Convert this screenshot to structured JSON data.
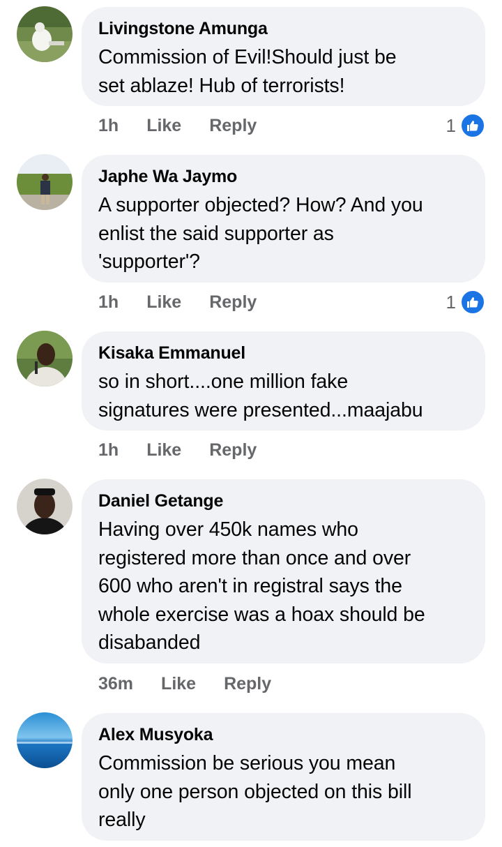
{
  "comments": [
    {
      "author": "Livingstone Amunga",
      "text": "Commission of Evil!Should just be\nset ablaze! Hub of terrorists!",
      "time": "1h",
      "like_label": "Like",
      "reply_label": "Reply",
      "reaction_count": "1",
      "avatar_icon": "avatar-photo"
    },
    {
      "author": "Japhe Wa Jaymo",
      "text": "A supporter objected? How? And you\nenlist the said supporter as\n'supporter'?",
      "time": "1h",
      "like_label": "Like",
      "reply_label": "Reply",
      "reaction_count": "1",
      "avatar_icon": "avatar-photo"
    },
    {
      "author": "Kisaka Emmanuel",
      "text": "so in short....one million fake\nsignatures were presented...maajabu",
      "time": "1h",
      "like_label": "Like",
      "reply_label": "Reply",
      "avatar_icon": "avatar-photo"
    },
    {
      "author": "Daniel Getange",
      "text": "Having over 450k names who\nregistered more than once and over\n600 who aren't in registral says the\nwhole exercise was a hoax should be\ndisabanded",
      "time": "36m",
      "like_label": "Like",
      "reply_label": "Reply",
      "avatar_icon": "avatar-photo"
    },
    {
      "author": "Alex Musyoka",
      "text": "Commission be serious you mean\nonly one person objected on this bill\nreally",
      "avatar_icon": "avatar-photo"
    }
  ],
  "colors": {
    "bubble": "#f0f2f5",
    "meta_text": "#65676b",
    "like_blue": "#1b74e4"
  }
}
